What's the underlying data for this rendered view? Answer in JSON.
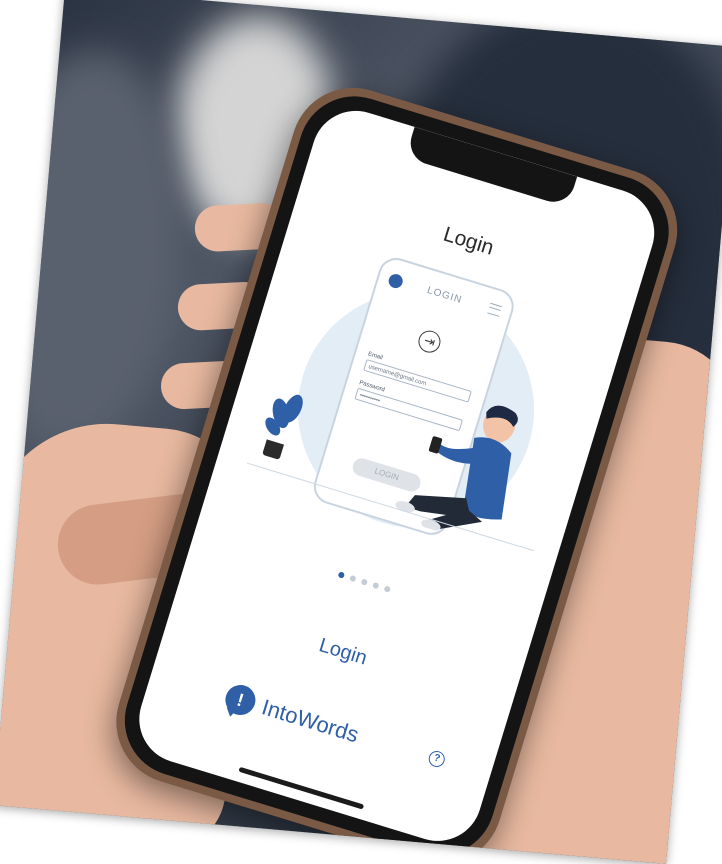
{
  "screen": {
    "title": "Login",
    "illustration": {
      "mock_title": "LOGIN",
      "email_label": "Email",
      "email_value": "username@gmail.com",
      "password_label": "Password",
      "password_value": "••••••••••",
      "button_label": "LOGIN"
    },
    "pagination": {
      "count": 5,
      "active_index": 0
    },
    "login_link": "Login",
    "brand_name": "IntoWords",
    "help_glyph": "?"
  },
  "colors": {
    "accent": "#2f5fa7",
    "screen_bg": "#ffffff",
    "illustration_bg": "#e3edf6"
  },
  "icons": [
    "intowords-logo-icon",
    "enter-icon",
    "menu-icon",
    "help-icon"
  ]
}
